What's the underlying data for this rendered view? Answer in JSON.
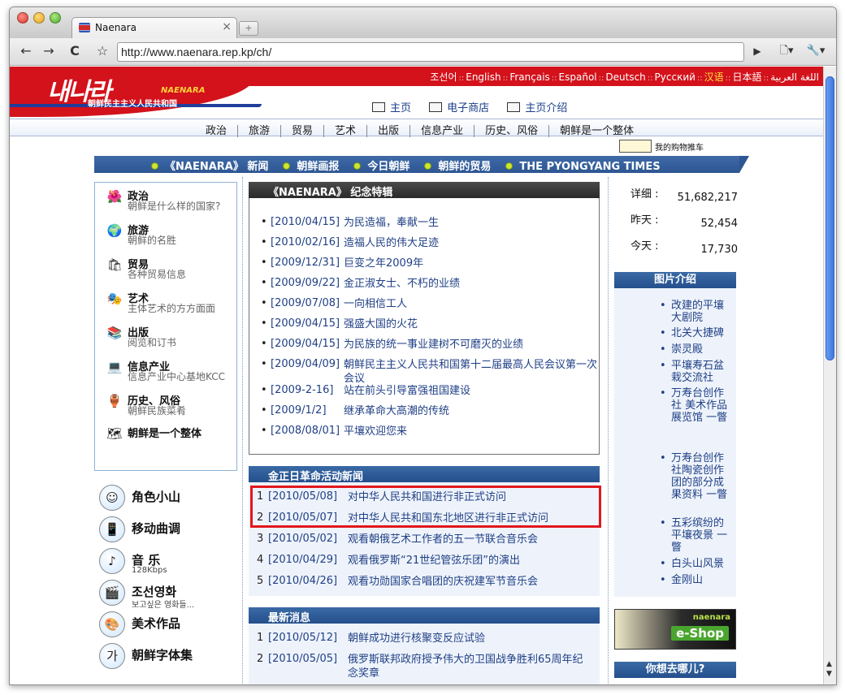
{
  "browser": {
    "tab_title": "Naenara",
    "tab_close": "×",
    "new_tab": "+",
    "url": "http://www.naenara.rep.kp/ch/",
    "back": "←",
    "forward": "→",
    "reload": "C",
    "star": "☆",
    "go": "▶",
    "page_menu": "🗋▾",
    "tools_menu": "🔧▾"
  },
  "header": {
    "logo_text": "내나라",
    "logo_en": "NAENARA",
    "logo_sub": "朝鲜民主主义人民共和国",
    "languages": [
      "조선어",
      "English",
      "Français",
      "Español",
      "Deutsch",
      "Русский",
      "汉语",
      "日本語",
      "اللغة العربية"
    ],
    "active_language": "汉语",
    "lang_sep": "::",
    "topnav": [
      "主页",
      "电子商店",
      "主页介绍"
    ]
  },
  "menu": [
    "政治",
    "旅游",
    "贸易",
    "艺术",
    "出版",
    "信息产业",
    "历史、风俗",
    "朝鲜是一个整体"
  ],
  "cart_label": "我的购物推车",
  "bluebar": [
    "《NAENARA》 新闻",
    "朝鲜画报",
    "今日朝鲜",
    "朝鲜的贸易",
    "THE PYONGYANG TIMES"
  ],
  "categories": [
    {
      "title": "政治",
      "desc": "朝鲜是什么样的国家?",
      "icon": "🌺"
    },
    {
      "title": "旅游",
      "desc": "朝鲜的名胜",
      "icon": "🌍"
    },
    {
      "title": "贸易",
      "desc": "各种贸易信息",
      "icon": "🛍"
    },
    {
      "title": "艺术",
      "desc": "主体艺术的方方面面",
      "icon": "🎭"
    },
    {
      "title": "出版",
      "desc": "阅览和订书",
      "icon": "📚"
    },
    {
      "title": "信息产业",
      "desc": "信息产业中心基地KCC",
      "icon": "💻"
    },
    {
      "title": "历史、风俗",
      "desc": "朝鲜民族菜肴",
      "icon": "🏺"
    },
    {
      "title": "朝鲜是一个整体",
      "desc": "",
      "icon": "🗺"
    }
  ],
  "media": [
    {
      "title": "角色小山",
      "sub": "",
      "icon": "☺"
    },
    {
      "title": "移动曲调",
      "sub": "",
      "icon": "📱"
    },
    {
      "title": "音 乐",
      "sub": "128Kbps",
      "icon": "♪"
    },
    {
      "title": "조선영화",
      "sub": "보고싶은 영화들...",
      "icon": "🎬"
    },
    {
      "title": "美术作品",
      "sub": "",
      "icon": "🎨"
    },
    {
      "title": "朝鲜字体集",
      "sub": "",
      "icon": "가"
    }
  ],
  "featured": {
    "heading": "《NAENARA》 纪念特辑",
    "items": [
      {
        "date": "[2010/04/15]",
        "text": "为民造福，奉献一生"
      },
      {
        "date": "[2010/02/16]",
        "text": "造福人民的伟大足迹"
      },
      {
        "date": "[2009/12/31]",
        "text": "巨变之年2009年"
      },
      {
        "date": "[2009/09/22]",
        "text": "金正淑女士、不朽的业绩"
      },
      {
        "date": "[2009/07/08]",
        "text": "一向相信工人"
      },
      {
        "date": "[2009/04/15]",
        "text": "强盛大国的火花"
      },
      {
        "date": "[2009/04/15]",
        "text": "为民族的统一事业建树不可磨灭的业绩"
      },
      {
        "date": "[2009/04/09]",
        "text": "朝鲜民主主义人民共和国第十二届最高人民会议第一次会议"
      },
      {
        "date": "[2009-2-16]",
        "text": "站在前头引导富强祖国建设"
      },
      {
        "date": "[2009/1/2]",
        "text": "继承革命大高潮的传统"
      },
      {
        "date": "[2008/08/01]",
        "text": "平壤欢迎您来"
      }
    ]
  },
  "kim_news": {
    "heading": "金正日革命活动新闻",
    "items": [
      {
        "num": "1",
        "date": "[2010/05/08]",
        "text": "对中华人民共和国进行非正式访问"
      },
      {
        "num": "2",
        "date": "[2010/05/07]",
        "text": "对中华人民共和国东北地区进行非正式访问"
      },
      {
        "num": "3",
        "date": "[2010/05/02]",
        "text": "观看朝俄艺术工作者的五一节联合音乐会"
      },
      {
        "num": "4",
        "date": "[2010/04/29]",
        "text": "观看俄罗斯“21世纪管弦乐团”的演出"
      },
      {
        "num": "5",
        "date": "[2010/04/26]",
        "text": "观看功勋国家合唱团的庆祝建军节音乐会"
      }
    ]
  },
  "latest": {
    "heading": "最新消息",
    "items": [
      {
        "num": "1",
        "date": "[2010/05/12]",
        "text": "朝鲜成功进行核聚变反应试验"
      },
      {
        "num": "2",
        "date": "[2010/05/05]",
        "text": "俄罗斯联邦政府授予伟大的卫国战争胜利65周年纪念奖章"
      }
    ]
  },
  "stats": [
    {
      "label": "详细 :",
      "value": "51,682,217"
    },
    {
      "label": "昨天 :",
      "value": "52,454"
    },
    {
      "label": "今天 :",
      "value": "17,730"
    }
  ],
  "pictures": {
    "heading": "图片介绍",
    "items": [
      "改建的平壤大剧院",
      "北关大捷碑",
      "崇灵殿",
      "平壤寿石盆栽交流社",
      "万寿台创作社 美术作品展览馆 一瞥",
      "万寿台创作社陶瓷创作团的部分成果资料 一瞥",
      "五彩缤纷的平壤夜景 一瞥",
      "白头山风景",
      "金刚山"
    ]
  },
  "eshop": {
    "label": "naenara",
    "logo": "e-Shop"
  },
  "where_heading": "你想去哪儿?",
  "colors": {
    "brand_red": "#d3121b",
    "nav_blue": "#2d5693",
    "highlight": "#e1171c"
  }
}
